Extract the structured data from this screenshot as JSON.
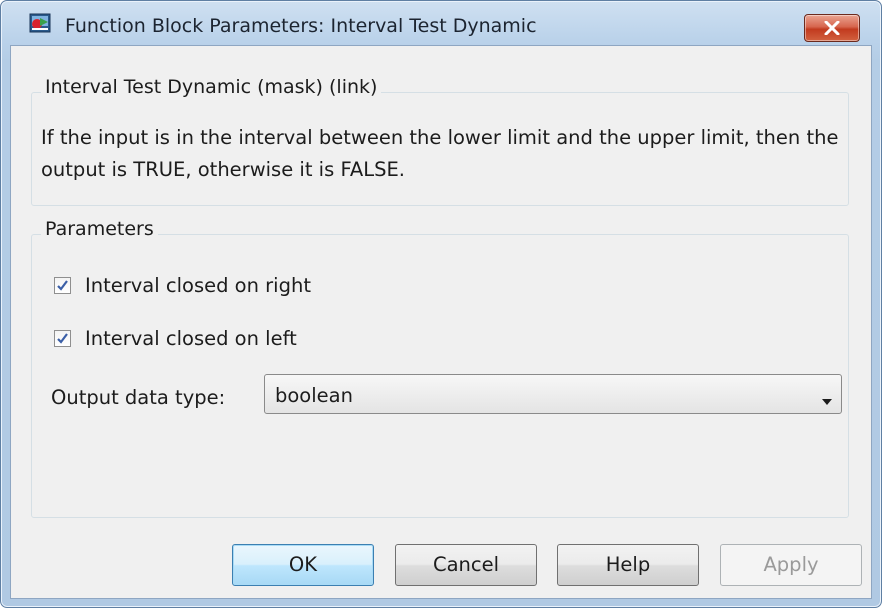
{
  "window": {
    "title": "Function Block Parameters: Interval Test Dynamic",
    "icon": "simulink-block-icon",
    "close_icon": "close-icon"
  },
  "description": {
    "group_label": "Interval Test Dynamic (mask) (link)",
    "text": "If the input is in the interval between the lower limit and the upper limit, then the output is TRUE, otherwise it is FALSE."
  },
  "parameters": {
    "group_label": "Parameters",
    "checkboxes": [
      {
        "label": "Interval closed on right",
        "checked": true
      },
      {
        "label": "Interval closed on left",
        "checked": true
      }
    ],
    "output_data_type": {
      "label": "Output data type:",
      "value": "boolean"
    }
  },
  "buttons": {
    "ok": "OK",
    "cancel": "Cancel",
    "help": "Help",
    "apply": "Apply"
  },
  "colors": {
    "close_button": "#c9462c",
    "ok_button_border": "#3c7fb1",
    "checkmark": "#3b5fa7"
  }
}
